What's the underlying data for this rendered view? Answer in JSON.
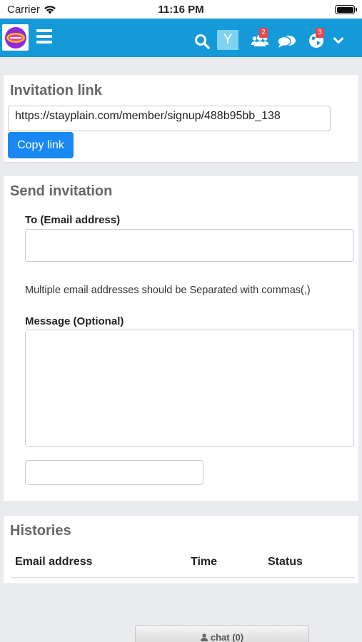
{
  "status_bar": {
    "carrier": "Carrier",
    "time": "11:16 PM"
  },
  "navbar": {
    "avatar_letter": "Y",
    "friend_requests_count": "2",
    "notifications_count": "3",
    "accent_color": "#149ad8",
    "icons": [
      "logo",
      "menu-icon",
      "search-icon",
      "friends-icon",
      "messages-icon",
      "globe-icon",
      "chevron-down-icon"
    ]
  },
  "invitation_link": {
    "title": "Invitation link",
    "url": "https://stayplain.com/member/signup/488b95bb_138",
    "copy_button": "Copy link"
  },
  "send_invitation": {
    "title": "Send invitation",
    "to_label": "To (Email address)",
    "to_value": "",
    "hint": "Multiple email addresses should be Separated with commas(,)",
    "message_label": "Message (Optional)",
    "message_value": "",
    "extra_input_value": ""
  },
  "histories": {
    "title": "Histories",
    "columns": [
      "Email address",
      "Time",
      "Status"
    ],
    "rows": []
  },
  "chat": {
    "label": "chat (0)"
  }
}
